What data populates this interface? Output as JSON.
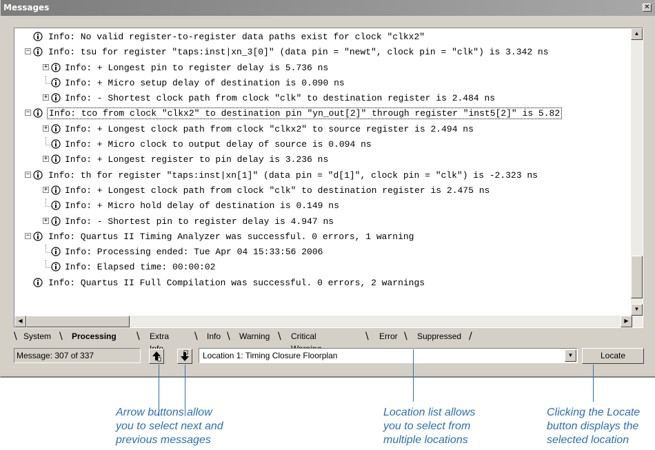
{
  "window": {
    "title": "Messages"
  },
  "messages": [
    {
      "indent": 0,
      "expander": "",
      "text": "Info: No valid register-to-register data paths exist for clock \"clkx2\""
    },
    {
      "indent": 0,
      "expander": "minus",
      "text": "Info: tsu for register \"taps:inst|xn_3[0]\" (data pin = \"newt\", clock pin = \"clk\") is 3.342 ns"
    },
    {
      "indent": 1,
      "expander": "plus",
      "text": "Info: + Longest pin to register delay is 5.736 ns"
    },
    {
      "indent": 1,
      "expander": "",
      "text": "Info: + Micro setup delay of destination is 0.090 ns"
    },
    {
      "indent": 1,
      "expander": "plus",
      "text": "Info: - Shortest clock path from clock \"clk\" to destination register is 2.484 ns"
    },
    {
      "indent": 0,
      "expander": "minus",
      "selected": true,
      "text": "Info: tco from clock \"clkx2\" to destination pin \"yn_out[2]\" through register \"inst5[2]\" is 5.82"
    },
    {
      "indent": 1,
      "expander": "plus",
      "text": "Info: + Longest clock path from clock \"clkx2\" to source register is 2.494 ns"
    },
    {
      "indent": 1,
      "expander": "",
      "text": "Info: + Micro clock to output delay of source is 0.094 ns"
    },
    {
      "indent": 1,
      "expander": "plus",
      "text": "Info: + Longest register to pin delay is 3.236 ns"
    },
    {
      "indent": 0,
      "expander": "minus",
      "text": "Info: th for register \"taps:inst|xn[1]\" (data pin = \"d[1]\", clock pin = \"clk\") is -2.323 ns"
    },
    {
      "indent": 1,
      "expander": "plus",
      "text": "Info: + Longest clock path from clock \"clk\" to destination register is 2.475 ns"
    },
    {
      "indent": 1,
      "expander": "",
      "text": "Info: + Micro hold delay of destination is 0.149 ns"
    },
    {
      "indent": 1,
      "expander": "plus",
      "text": "Info: - Shortest pin to register delay is 4.947 ns"
    },
    {
      "indent": 0,
      "expander": "minus",
      "text": "Info: Quartus II Timing Analyzer was successful. 0 errors, 1 warning"
    },
    {
      "indent": 1,
      "expander": "",
      "text": "Info: Processing ended: Tue Apr 04 15:33:56 2006"
    },
    {
      "indent": 1,
      "expander": "",
      "text": "Info: Elapsed time: 00:00:02"
    },
    {
      "indent": 0,
      "expander": "",
      "text": "Info: Quartus II Full Compilation was successful. 0 errors, 2 warnings"
    }
  ],
  "tabs": [
    "System",
    "Processing",
    "Extra Info",
    "Info",
    "Warning",
    "Critical Warning",
    "Error",
    "Suppressed"
  ],
  "active_tab": "Processing",
  "status": {
    "message_count": "Message: 307 of 337"
  },
  "location": {
    "value": "Location 1: Timing Closure Floorplan"
  },
  "locate_button": "Locate",
  "callouts": {
    "arrows": [
      "Arrow buttons allow",
      "you to select next and",
      "previous messages"
    ],
    "location": [
      "Location list allows",
      "you to select from",
      "multiple locations"
    ],
    "locate": [
      "Clicking the Locate",
      "button displays the",
      "selected location"
    ]
  },
  "colors": {
    "callout": "#2b6fb6",
    "titlebar": "#8a8a8a",
    "chrome": "#d4d0c8"
  }
}
